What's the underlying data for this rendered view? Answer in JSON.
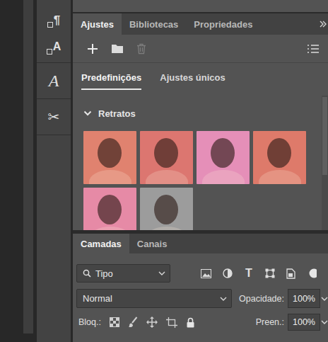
{
  "tool_strip": [
    {
      "kind": "paragraph",
      "glyph": "¶"
    },
    {
      "kind": "character",
      "glyph": "A"
    },
    {
      "kind": "glyph",
      "glyph": "A"
    },
    {
      "kind": "tool",
      "glyph": "✂"
    }
  ],
  "adjust_panel": {
    "tabs": [
      {
        "label": "Ajustes",
        "selected": true
      },
      {
        "label": "Bibliotecas",
        "selected": false
      },
      {
        "label": "Propriedades",
        "selected": false
      }
    ],
    "toolbar": {
      "trash_disabled": true
    },
    "subtabs": [
      {
        "label": "Predefinições",
        "selected": true
      },
      {
        "label": "Ajustes únicos",
        "selected": false
      }
    ],
    "group": {
      "title": "Retratos",
      "expanded": true,
      "presets": [
        {
          "color": "#e0826f"
        },
        {
          "color": "#dc7670"
        },
        {
          "color": "#e58fb8"
        },
        {
          "color": "#de7a6a"
        },
        {
          "color": "#e68aa6"
        },
        {
          "color": "#9c9c9c"
        }
      ]
    }
  },
  "layers_panel": {
    "tabs": [
      {
        "label": "Camadas",
        "selected": true
      },
      {
        "label": "Canais",
        "selected": false
      }
    ],
    "filter": {
      "placeholder": "Tipo",
      "text_glyph": "T"
    },
    "blend_mode": "Normal",
    "opacity": {
      "label": "Opacidade:",
      "value": "100%"
    },
    "lock": {
      "label": "Bloq.:"
    },
    "fill": {
      "label": "Preen.:",
      "value": "100%"
    }
  }
}
